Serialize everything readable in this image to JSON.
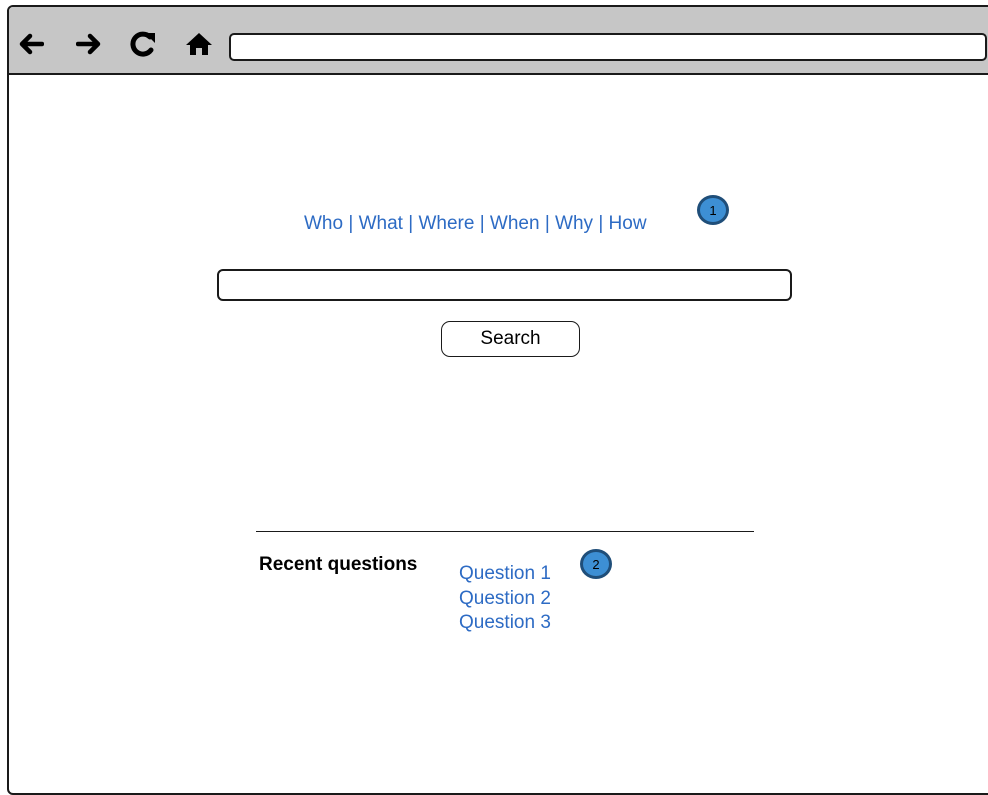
{
  "browser": {
    "nav_icons": [
      "back-arrow-icon",
      "forward-arrow-icon",
      "reload-icon",
      "home-icon"
    ],
    "address_value": ""
  },
  "page": {
    "question_nav": {
      "items": [
        "Who",
        "What",
        "Where",
        "When",
        "Why",
        "How"
      ],
      "separator": "|"
    },
    "callouts": [
      "1",
      "2"
    ],
    "search": {
      "input_value": "",
      "button_label": "Search"
    },
    "recent": {
      "label": "Recent questions",
      "items": [
        "Question 1",
        "Question 2",
        "Question 3"
      ]
    }
  },
  "colors": {
    "toolbar": "#c6c6c6",
    "link": "#2d6bc4",
    "callout_fill": "#3d8fd4",
    "callout_border": "#1f4e79"
  }
}
